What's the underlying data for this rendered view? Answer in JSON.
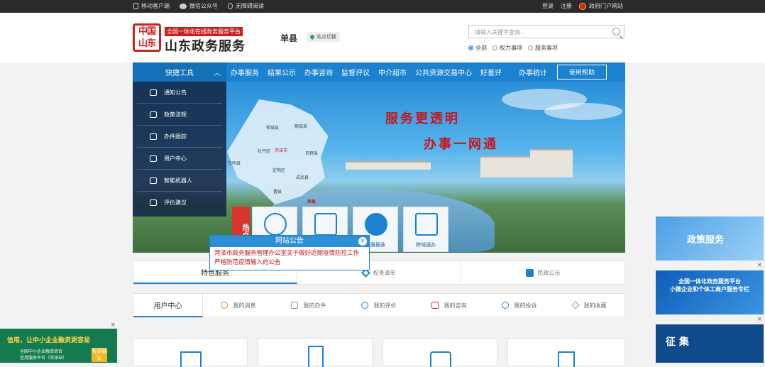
{
  "topbar": {
    "mobile": "移动客户端",
    "wechat": "微信公众号",
    "accessible": "无障碍阅读",
    "login": "登录",
    "register": "注册",
    "portal": "政府门户网站"
  },
  "header": {
    "logo_seal": "中国\n山东",
    "logo_sub": "全国一体化在线政务服务平台",
    "logo_title": "山东政务服务",
    "county": "单县",
    "switch": "站点切换",
    "search_placeholder": "请输入关键字查询...",
    "radios": [
      "全部",
      "权力事项",
      "服务事项"
    ],
    "radio_selected": "全部"
  },
  "nav": {
    "tool": "快捷工具",
    "items": [
      "办事服务",
      "结果公示",
      "办事咨询",
      "监督评议",
      "中介超市",
      "公共资源交易中心",
      "好差评",
      "办事统计"
    ],
    "help": "使用帮助"
  },
  "quick_menu": [
    "通知公告",
    "政策法规",
    "办件跟踪",
    "用户中心",
    "智能机器人",
    "评价建议"
  ],
  "banner": {
    "slogan1": "服务更透明",
    "slogan2": "办事一网通",
    "map_labels": [
      "郓城县",
      "鄄城县",
      "牡丹区",
      "东明县",
      "定陶区",
      "巨野县",
      "成武县",
      "曹县",
      "单县",
      "菏泽市"
    ],
    "hot": "热点",
    "cards": [
      "",
      "",
      "气暖报装",
      "跨域通办"
    ]
  },
  "popup": {
    "title": "网站公告",
    "close": "×",
    "body": "菏泽市政务服务管理办公室关于做好近期疫情防控工作严格防范疫情输入的公告"
  },
  "tabs": [
    "特色服务",
    "权责清单",
    "民政公示"
  ],
  "user_center": {
    "title": "用户中心",
    "items": [
      "我的消息",
      "我的办件",
      "我的评价",
      "我的咨询",
      "我的投诉",
      "我的收藏"
    ]
  },
  "ads": {
    "left_title": "信用，让中小企业融资更容易",
    "left_sub": "全国中小企业融资综合\n信用服务平台（菏泽站）",
    "left_btn": "我要融资",
    "close": "×",
    "right1": "政策服务",
    "right2": "全国一体化政务服务平台\n小微企业和个体工商户服务专栏",
    "right3": "征 集"
  },
  "colors": {
    "nav": "#1b82d1",
    "accent_red": "#c8161d"
  }
}
